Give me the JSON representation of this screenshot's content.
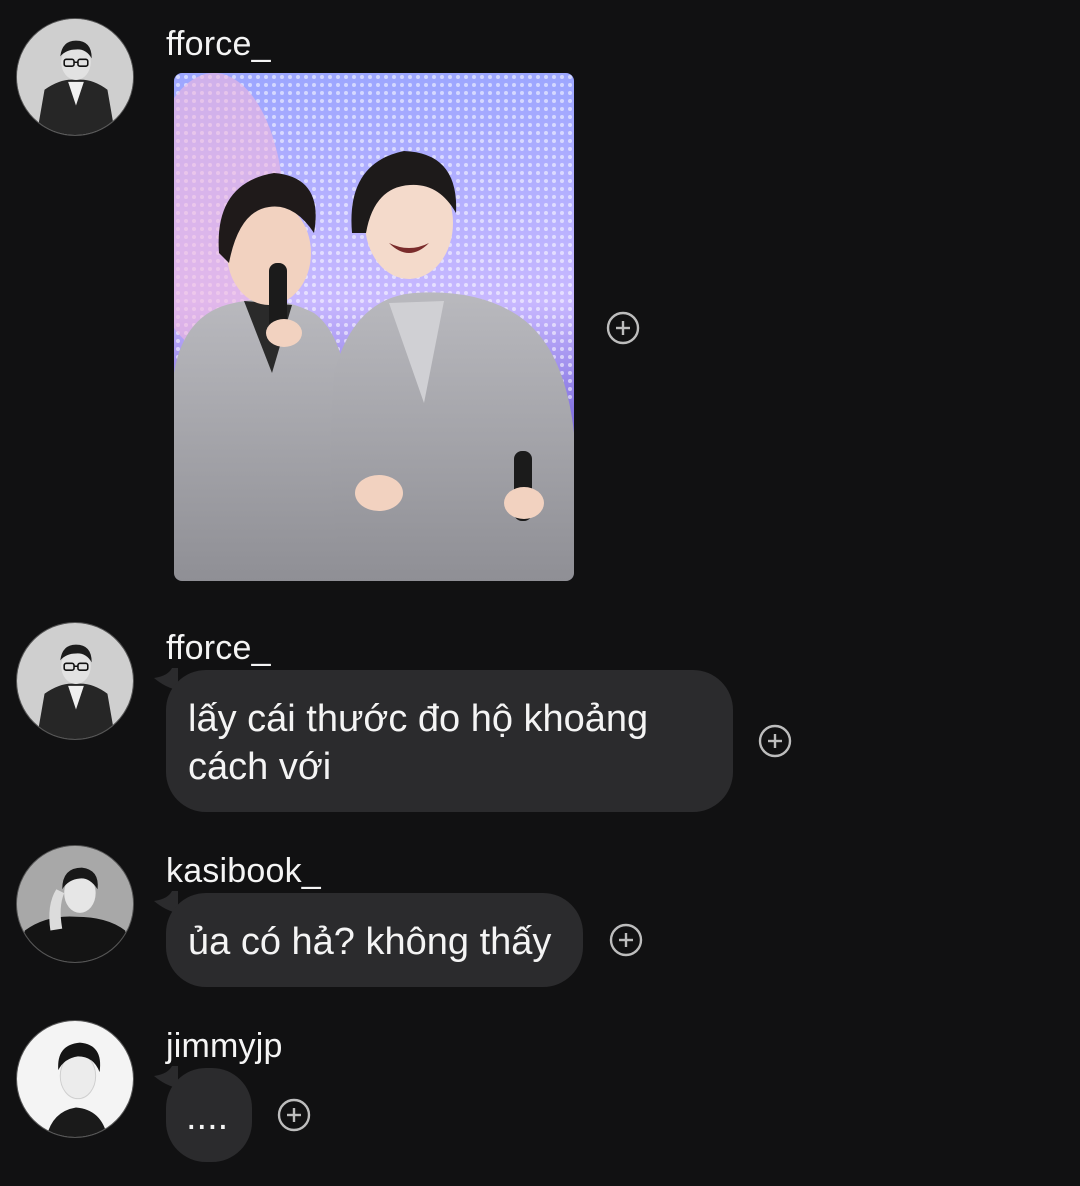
{
  "messages": [
    {
      "user": "fforce_",
      "avatar_icon": "avatar-glasses-man-icon",
      "type": "image",
      "image_alt": "photo"
    },
    {
      "user": "fforce_",
      "avatar_icon": "avatar-glasses-man-icon",
      "type": "text",
      "lines": [
        "lấy cái thước đo hộ khoảng",
        "cách với"
      ]
    },
    {
      "user": "kasibook_",
      "avatar_icon": "avatar-hand-pose-man-icon",
      "type": "text",
      "text": "ủa có hả? không thấy"
    },
    {
      "user": "jimmyjp",
      "avatar_icon": "avatar-profile-man-icon",
      "type": "text",
      "text": "...."
    }
  ],
  "icons": {
    "react": "add-reaction-icon"
  },
  "colors": {
    "background": "#111112",
    "bubble": "#2b2b2d",
    "text": "#f4f4f4",
    "icon": "#bdbdbd"
  }
}
